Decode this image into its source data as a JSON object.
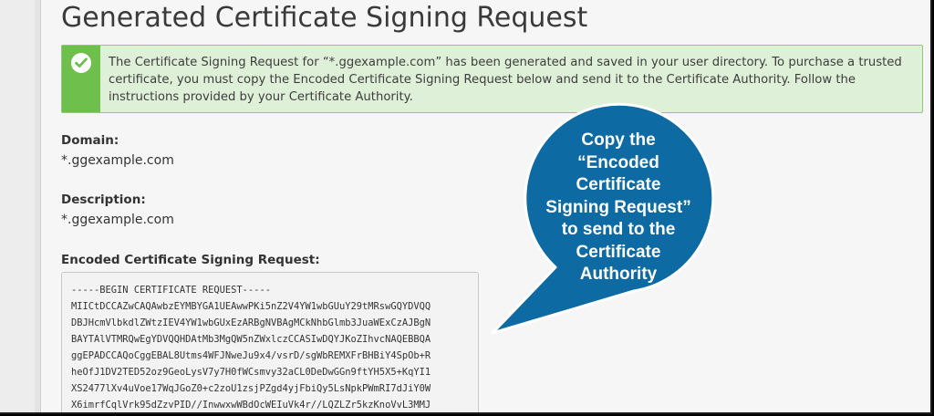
{
  "page": {
    "title": "Generated Certificate Signing Request"
  },
  "alert": {
    "icon": "check-circle-icon",
    "message": "The Certificate Signing Request for “*.ggexample.com” has been generated and saved in your user directory. To purchase a trusted certificate, you must copy the Encoded Certificate Signing Request below and send it to the Certificate Authority. Follow the instructions provided by your Certificate Authority.",
    "accent_color": "#6fbf4c",
    "background_color": "#dff0d8"
  },
  "domain": {
    "label": "Domain:",
    "value": "*.ggexample.com"
  },
  "description": {
    "label": "Description:",
    "value": "*.ggexample.com"
  },
  "csr": {
    "label": "Encoded Certificate Signing Request:",
    "lines": [
      "-----BEGIN CERTIFICATE REQUEST-----",
      "MIICtDCCAZwCAQAwbzEYMBYGA1UEAwwPKi5nZ2V4YW1wbGUuY29tMRswGQYDVQQ",
      "DBJHcmVlbkdlZWtzIEV4YW1wbGUxEzARBgNVBAgMCkNhbGlmb3JuaWExCzAJBgN",
      "BAYTAlVTMRQwEgYDVQQHDAtMb3MgQW5nZWxlczCCASIwDQYJKoZIhvcNAQEBBQA",
      "ggEPADCCAQoCggEBAL8Utms4WFJNweJu9x4/vsrD/sgWbREMXFrBHBiY4SpOb+R",
      "heOfJ1DV2TED52oz9GeoLysV7y7H0fWCsmvy32aCL0DeDwGGn9ftYH5X5+KqYI1",
      "XS2477lXv4uVoe17WqJGoZ0+c2zoU1zsjPZgd4yjFbiQy5LsNpkPWmRI7dJiY0W",
      "X6imrfCqlVrk95dZzvPID//InwwxwWBdOcWEIuVk4r//LQZLZr5kzKnoVvL3MMJ"
    ]
  },
  "callout": {
    "text": "Copy the\n“Encoded\nCertificate\nSigning Request”\nto send to the\nCertificate\nAuthority",
    "color": "#0e6aa3"
  }
}
